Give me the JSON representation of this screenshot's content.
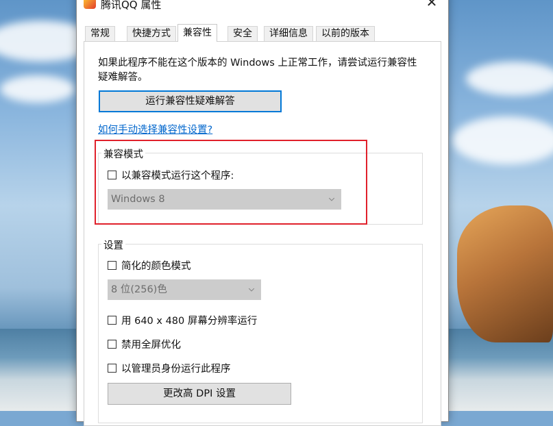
{
  "window": {
    "title": "腾讯QQ 属性",
    "close_glyph": "✕"
  },
  "tabs": [
    {
      "label": "常规"
    },
    {
      "label": "快捷方式"
    },
    {
      "label": "兼容性"
    },
    {
      "label": "安全"
    },
    {
      "label": "详细信息"
    },
    {
      "label": "以前的版本"
    }
  ],
  "active_tab": "兼容性",
  "compat": {
    "intro": "如果此程序不能在这个版本的 Windows 上正常工作，请尝试运行兼容性疑难解答。",
    "troubleshoot_button": "运行兼容性疑难解答",
    "manual_link": "如何手动选择兼容性设置?"
  },
  "compat_mode": {
    "group_title": "兼容模式",
    "checkbox_label": "以兼容模式运行这个程序:",
    "checked": false,
    "os_select_value": "Windows 8"
  },
  "settings": {
    "group_title": "设置",
    "reduced_color": {
      "label": "简化的颜色模式",
      "checked": false
    },
    "color_select_value": "8 位(256)色",
    "resolution": {
      "label": "用 640 x 480 屏幕分辨率运行",
      "checked": false
    },
    "disable_fullscreen": {
      "label": "禁用全屏优化",
      "checked": false
    },
    "run_as_admin": {
      "label": "以管理员身份运行此程序",
      "checked": false
    },
    "dpi_button": "更改高 DPI 设置"
  },
  "colors": {
    "accent": "#0078d7",
    "link": "#0066cc",
    "highlight": "#e0202a"
  }
}
